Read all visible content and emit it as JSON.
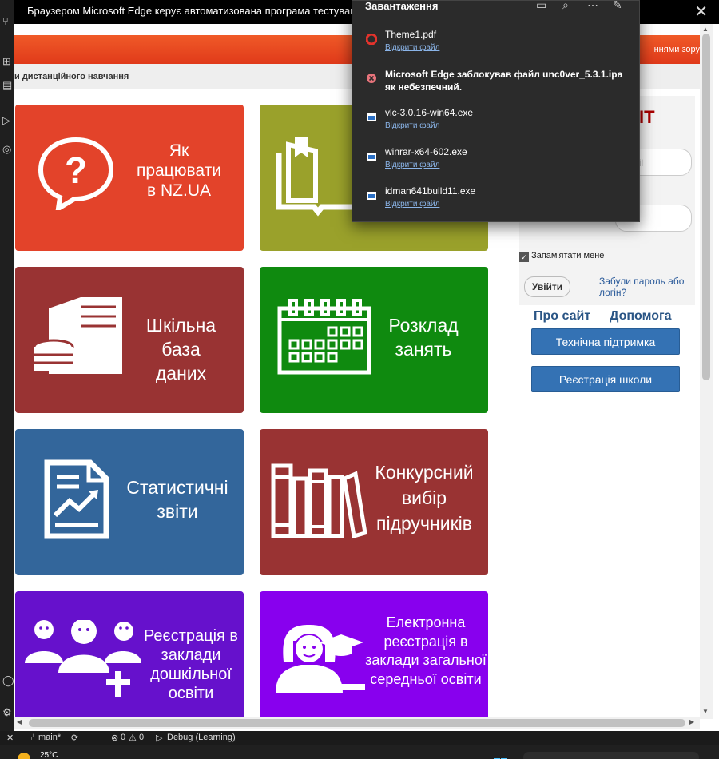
{
  "titlebar": {
    "text": "Браузером Microsoft Edge керує автоматизована програма тестування."
  },
  "site": {
    "vision_text": "ннями зору",
    "subheader": "и дистанційного навчання",
    "brand_partial": "IT",
    "email_placeholder": "mail",
    "tiles": [
      {
        "label": "Як працювати в NZ.UA",
        "color": "#e3432a",
        "icon": "question-bubble-icon"
      },
      {
        "label": "",
        "color": "#9aa12b",
        "icon": "book-icon"
      },
      {
        "label": "Шкільна база даних",
        "color": "#993333",
        "icon": "database-server-icon"
      },
      {
        "label": "Розклад занять",
        "color": "#0f8a0f",
        "icon": "calendar-icon"
      },
      {
        "label": "Статистичні звіти",
        "color": "#33669b",
        "icon": "report-chart-icon"
      },
      {
        "label": "Конкурсний вибір підручників",
        "color": "#993333",
        "icon": "books-icon"
      },
      {
        "label": "Реєстрація в заклади дошкільної освіти",
        "color": "#6611cc",
        "icon": "people-add-icon"
      },
      {
        "label": "Електронна реєстрація в заклади загальної середньої освіти",
        "color": "#8800ee",
        "icon": "graduate-icon"
      }
    ],
    "login": {
      "remember": "Запам'ятати мене",
      "submit": "Увійти",
      "forgot": "Забули пароль або логін?"
    },
    "links": {
      "about": "Про сайт",
      "help": "Допомога"
    },
    "buttons": {
      "support": "Технічна підтримка",
      "register": "Реєстрація школи"
    }
  },
  "downloads": {
    "title": "Завантаження",
    "items": [
      {
        "name": "Theme1.pdf",
        "action": "Відкрити файл",
        "icon": "pdf-icon"
      },
      {
        "name": "Microsoft Edge заблокував файл unc0ver_5.3.1.ipa як небезпечний.",
        "action": "",
        "icon": "blocked-icon"
      },
      {
        "name": "vlc-3.0.16-win64.exe",
        "action": "Відкрити файл",
        "icon": "exe-icon"
      },
      {
        "name": "winrar-x64-602.exe",
        "action": "Відкрити файл",
        "icon": "exe-icon"
      },
      {
        "name": "idman641build11.exe",
        "action": "Відкрити файл",
        "icon": "exe-icon"
      }
    ]
  },
  "statusbar": {
    "branch": "main*",
    "errors": "0",
    "warnings": "0",
    "debug": "Debug (Learning)"
  },
  "taskbar": {
    "temp": "25°C"
  }
}
